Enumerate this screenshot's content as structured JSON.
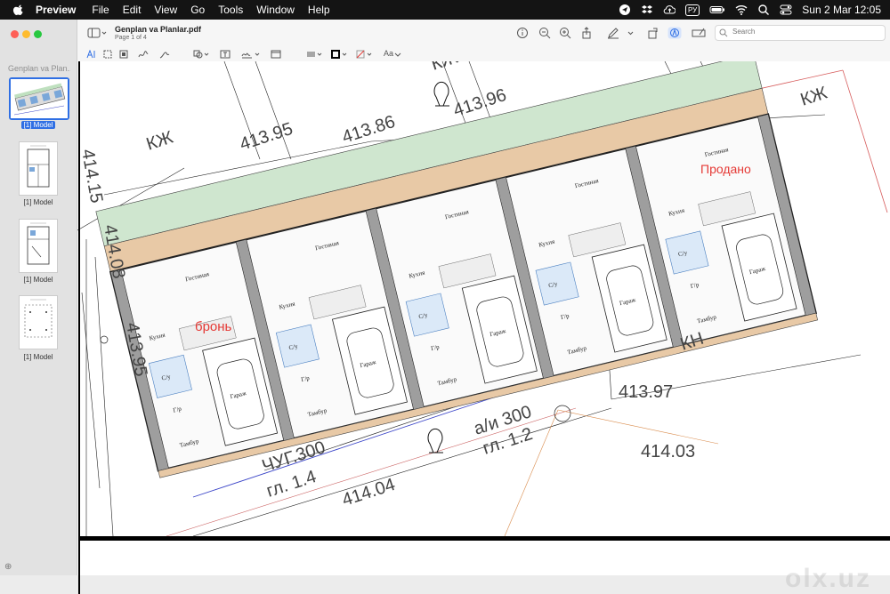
{
  "menubar": {
    "app": "Preview",
    "items": [
      "File",
      "Edit",
      "View",
      "Go",
      "Tools",
      "Window",
      "Help"
    ],
    "input_source": "РУ",
    "datetime": "Sun 2 Mar  12:05"
  },
  "sidebar": {
    "title": "Genplan va Plan...",
    "thumbnails": [
      {
        "label": "[1] Model",
        "selected": true
      },
      {
        "label": "[1] Model",
        "selected": false
      },
      {
        "label": "[1] Model",
        "selected": false
      },
      {
        "label": "[1] Model",
        "selected": false
      }
    ]
  },
  "toolbar": {
    "doc_title": "Genplan va Planlar.pdf",
    "page_info": "Page 1 of 4",
    "search_placeholder": "Search"
  },
  "markup": {
    "text_style": "Aa"
  },
  "drawing": {
    "labels": {
      "kzh_1": "КЖ",
      "kzh_2": "КЖ",
      "kzh_3": "КЖ",
      "kn": "КН",
      "elev_413_95": "413.95",
      "elev_413_86": "413.86",
      "elev_413_96": "413.96",
      "elev_414_15": "414.15",
      "elev_414_08": "414.08",
      "elev_413_95b": "413.95",
      "elev_413_97": "413.97",
      "elev_414_03": "414.03",
      "elev_414_04": "414.04",
      "chug": "ЧУГ.300",
      "gl_14": "гл. 1.4",
      "ai": "а/и 300",
      "gl_12": "гл. 1.2",
      "bron": "бронь",
      "prodano": "Продано"
    },
    "room": {
      "kitchen": "Кухня",
      "living": "Гостиная",
      "bath": "С/у",
      "hall": "Г/р",
      "vest": "Тамбур",
      "garage": "Гараж"
    },
    "colors": {
      "status_red": "#e53935",
      "pink_line": "#d65a5a",
      "blue_line": "#3b45c8",
      "green_hatch": "#cfe6cf",
      "wall_gray": "#9e9e9e"
    }
  },
  "watermark": "olx.uz"
}
